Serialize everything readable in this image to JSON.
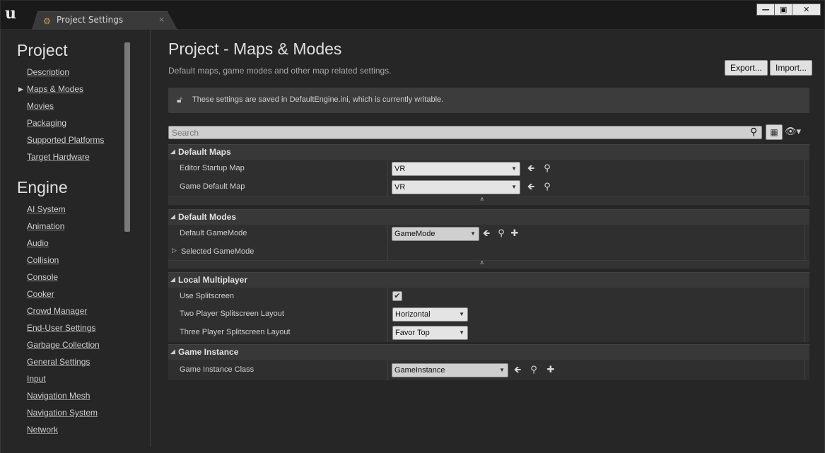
{
  "window": {
    "tab_label": "Project Settings",
    "tab_close": "×",
    "controls": {
      "minimize": "—",
      "maximize": "▣",
      "close": "✕"
    }
  },
  "sidebar": {
    "project_heading": "Project",
    "project_items": [
      "Description",
      "Maps & Modes",
      "Movies",
      "Packaging",
      "Supported Platforms",
      "Target Hardware"
    ],
    "selected_item": "Maps & Modes",
    "engine_heading": "Engine",
    "engine_items": [
      "AI System",
      "Animation",
      "Audio",
      "Collision",
      "Console",
      "Cooker",
      "Crowd Manager",
      "End-User Settings",
      "Garbage Collection",
      "General Settings",
      "Input",
      "Navigation Mesh",
      "Navigation System",
      "Network"
    ]
  },
  "header": {
    "title": "Project - Maps & Modes",
    "subtitle": "Default maps, game modes and other map related settings.",
    "export_label": "Export...",
    "import_label": "Import..."
  },
  "notice": {
    "text": "These settings are saved in DefaultEngine.ini, which is currently writable."
  },
  "search": {
    "placeholder": "Search"
  },
  "sections": {
    "default_maps": {
      "title": "Default Maps",
      "editor_startup_map_label": "Editor Startup Map",
      "editor_startup_map_value": "VR",
      "game_default_map_label": "Game Default Map",
      "game_default_map_value": "VR"
    },
    "default_modes": {
      "title": "Default Modes",
      "default_gamemode_label": "Default GameMode",
      "default_gamemode_value": "GameMode",
      "selected_gamemode_label": "Selected GameMode"
    },
    "local_multiplayer": {
      "title": "Local Multiplayer",
      "use_splitscreen_label": "Use Splitscreen",
      "use_splitscreen_checked": true,
      "two_player_label": "Two Player Splitscreen Layout",
      "two_player_value": "Horizontal",
      "three_player_label": "Three Player Splitscreen Layout",
      "three_player_value": "Favor Top"
    },
    "game_instance": {
      "title": "Game Instance",
      "game_instance_class_label": "Game Instance Class",
      "game_instance_class_value": "GameInstance"
    }
  },
  "icons": {
    "tab": "gear-icon",
    "notice": "lock-icon",
    "search": "search-icon",
    "grid": "grid-view-icon",
    "visibility": "eye-icon"
  }
}
